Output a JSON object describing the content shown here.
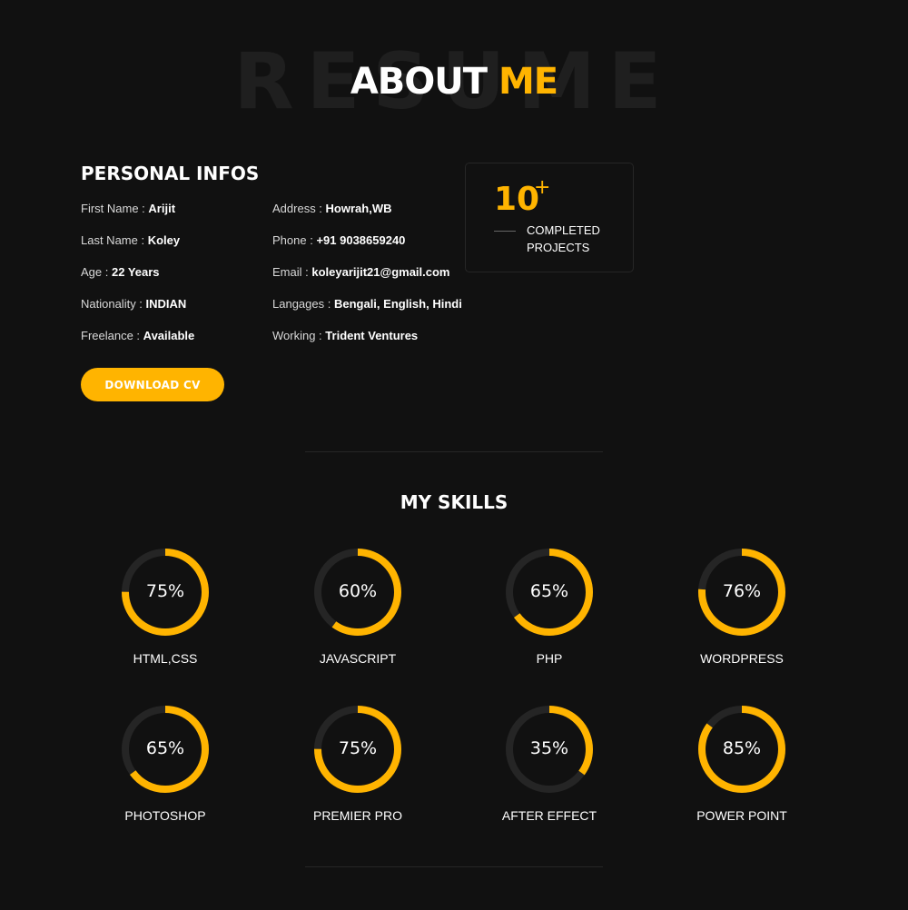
{
  "heading": {
    "background_word": "RESUME",
    "title_white": "ABOUT",
    "title_accent": "ME"
  },
  "personal": {
    "title": "PERSONAL INFOS",
    "left": [
      {
        "label": "First Name :",
        "value": "Arijit"
      },
      {
        "label": "Last Name :",
        "value": "Koley"
      },
      {
        "label": "Age :",
        "value": "22 Years"
      },
      {
        "label": "Nationality :",
        "value": "INDIAN"
      },
      {
        "label": "Freelance :",
        "value": "Available"
      }
    ],
    "right": [
      {
        "label": "Address :",
        "value": "Howrah,WB"
      },
      {
        "label": "Phone :",
        "value": "+91 9038659240"
      },
      {
        "label": "Email :",
        "value": "koleyarijit21@gmail.com"
      },
      {
        "label": "Langages :",
        "value": "Bengali, English, Hindi"
      },
      {
        "label": "Working :",
        "value": "Trident Ventures"
      }
    ],
    "download_label": "DOWNLOAD CV"
  },
  "stats": {
    "number": "10",
    "plus": "+",
    "label_line1": "COMPLETED",
    "label_line2": "PROJECTS"
  },
  "skills": {
    "title": "MY SKILLS",
    "items": [
      {
        "name": "HTML,CSS",
        "percent": 75,
        "label": "75%"
      },
      {
        "name": "JAVASCRIPT",
        "percent": 60,
        "label": "60%"
      },
      {
        "name": "PHP",
        "percent": 65,
        "label": "65%"
      },
      {
        "name": "WORDPRESS",
        "percent": 76,
        "label": "76%"
      },
      {
        "name": "PHOTOSHOP",
        "percent": 65,
        "label": "65%"
      },
      {
        "name": "PREMIER PRO",
        "percent": 75,
        "label": "75%"
      },
      {
        "name": "AFTER EFFECT",
        "percent": 35,
        "label": "35%"
      },
      {
        "name": "POWER POINT",
        "percent": 85,
        "label": "85%"
      }
    ]
  },
  "colors": {
    "accent": "#ffb400",
    "background": "#111111",
    "track": "#252525"
  }
}
